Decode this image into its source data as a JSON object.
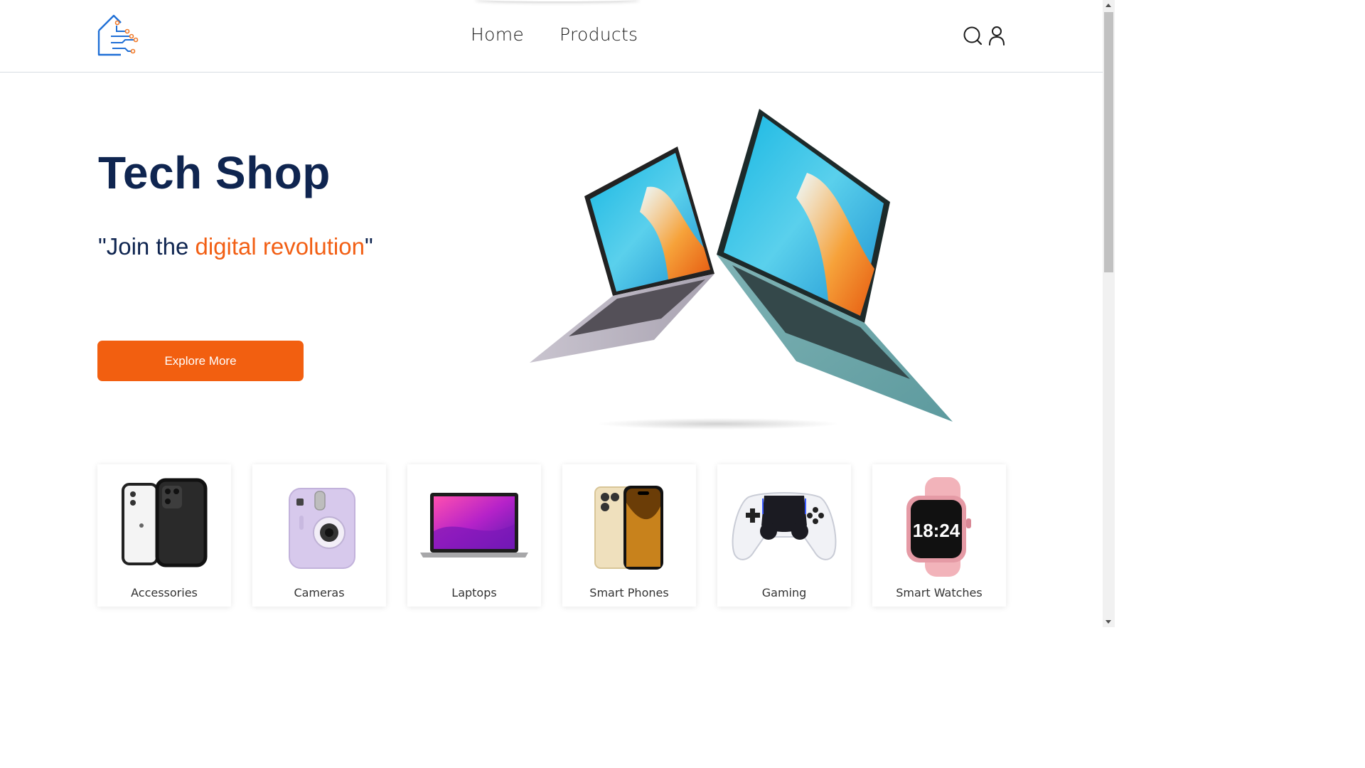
{
  "header": {
    "logo_icon": "circuit-house-logo",
    "nav": [
      {
        "label": "Home"
      },
      {
        "label": "Products"
      }
    ],
    "icons": [
      "search-icon",
      "user-icon"
    ]
  },
  "hero": {
    "title": "Tech Shop",
    "quote_open": "\"Join the ",
    "quote_accent": "digital revolution",
    "quote_close": "\"",
    "button_label": "Explore More",
    "image": "laptops-image"
  },
  "categories": [
    {
      "label": "Accessories",
      "image": "phone-cases-image"
    },
    {
      "label": "Cameras",
      "image": "instant-camera-image"
    },
    {
      "label": "Laptops",
      "image": "laptop-image"
    },
    {
      "label": "Smart Phones",
      "image": "smartphone-image"
    },
    {
      "label": "Gaming",
      "image": "game-controller-image"
    },
    {
      "label": "Smart Watches",
      "image": "smartwatch-image"
    }
  ],
  "watch_face_text": "18:24",
  "colors": {
    "accent": "#f25f10",
    "title": "#0f2550",
    "logo_blue": "#1f6fd6",
    "logo_orange": "#f07a2a"
  }
}
